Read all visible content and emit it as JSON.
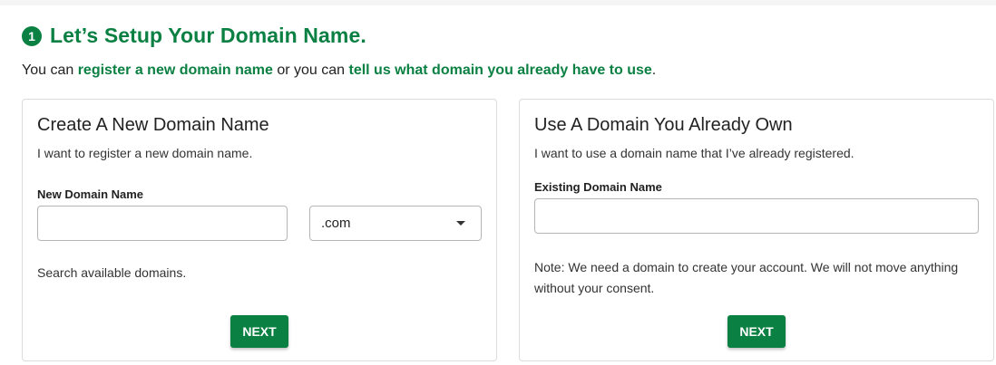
{
  "header": {
    "step_number": "1",
    "title": "Let’s Setup Your Domain Name."
  },
  "intro": {
    "prefix": "You can ",
    "link_register": "register a new domain name",
    "middle": " or you can ",
    "link_existing": "tell us what domain you already have to use",
    "suffix": "."
  },
  "new_domain_card": {
    "title": "Create A New Domain Name",
    "description": "I want to register a new domain name.",
    "field_label": "New Domain Name",
    "input_value": "",
    "tld_selected": ".com",
    "hint": "Search available domains.",
    "button_label": "NEXT"
  },
  "existing_domain_card": {
    "title": "Use A Domain You Already Own",
    "description": "I want to use a domain name that I’ve already registered.",
    "field_label": "Existing Domain Name",
    "input_value": "",
    "note": "Note: We need a domain to create your account. We will not move anything without your consent.",
    "button_label": "NEXT"
  },
  "colors": {
    "brand_green": "#0b8043",
    "border": "#dcdcdc",
    "input_border": "#b5b5b5"
  }
}
